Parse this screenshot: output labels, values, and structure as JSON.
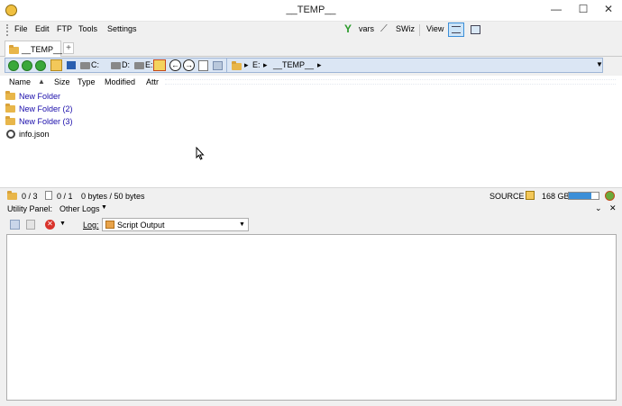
{
  "window": {
    "title": "__TEMP__",
    "minimize": "—",
    "maximize": "☐",
    "close": "✕"
  },
  "menu": {
    "items": [
      "File",
      "Edit",
      "FTP",
      "Tools",
      "Settings"
    ],
    "vars_label": "vars",
    "swiz_label": "SWiz",
    "view_label": "View"
  },
  "tabs": {
    "active": "__TEMP__",
    "add": "+"
  },
  "address": {
    "drives": [
      "C:",
      "D:",
      "E:"
    ],
    "path": [
      "E:",
      "__TEMP__"
    ]
  },
  "columns": [
    "Name",
    "Size",
    "Type",
    "Modified",
    "Attr"
  ],
  "files": [
    {
      "name": "New Folder",
      "kind": "folder"
    },
    {
      "name": "New Folder (2)",
      "kind": "folder"
    },
    {
      "name": "New Folder (3)",
      "kind": "folder"
    },
    {
      "name": "info.json",
      "kind": "file"
    }
  ],
  "status": {
    "folders": "0 / 3",
    "files": "0 / 1",
    "bytes": "0 bytes / 50 bytes",
    "source": "SOURCE",
    "free": "168 GB",
    "disk_used_fraction": 0.75
  },
  "utility": {
    "panel_label": "Utility Panel:",
    "other_logs": "Other Logs",
    "log_label": "Log:",
    "log_selected": "Script Output"
  },
  "colors": {
    "folder_text": "#1a0dab",
    "accent": "#3c8fd8"
  }
}
